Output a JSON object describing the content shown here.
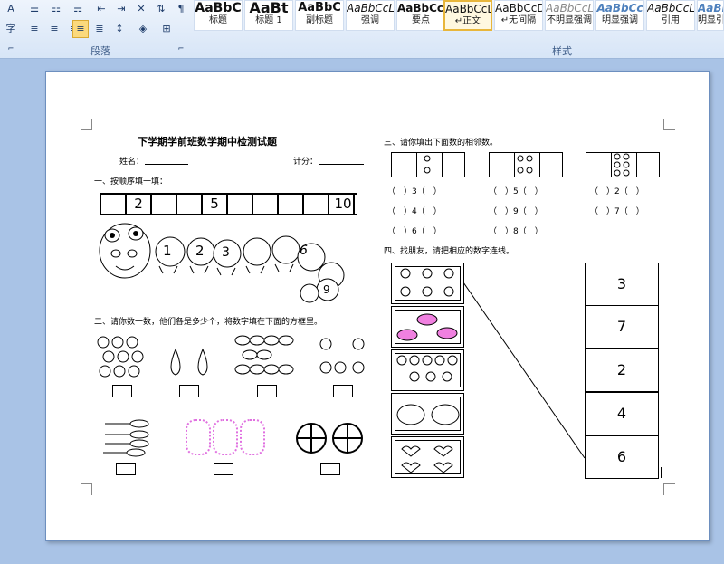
{
  "ribbon": {
    "group_paragraph": "段落",
    "group_styles": "样式",
    "styles": [
      {
        "preview": "AaBbC",
        "label": "标题"
      },
      {
        "preview": "AaBt",
        "label": "标题 1"
      },
      {
        "preview": "AaBbC",
        "label": "副标题"
      },
      {
        "preview": "AaBbCcL",
        "label": "强调"
      },
      {
        "preview": "AaBbCcl",
        "label": "要点"
      },
      {
        "preview": "AaBbCcD",
        "label": "↵正文"
      },
      {
        "preview": "AaBbCcD",
        "label": "↵无间隔"
      },
      {
        "preview": "AaBbCcL",
        "label": "不明显强调"
      },
      {
        "preview": "AaBbCc",
        "label": "明显强调"
      },
      {
        "preview": "AaBbCcL",
        "label": "引用"
      },
      {
        "preview": "AaBb",
        "label": "明显引"
      }
    ],
    "left_glyphs": [
      "A",
      "字"
    ]
  },
  "doc": {
    "title": "下学期学前班数学期中检测试题",
    "name_label": "姓名：",
    "score_label": "计分：",
    "q1": "一、按顺序填一填：",
    "seq": [
      "",
      "2",
      "",
      "",
      "5",
      "",
      "",
      "",
      "",
      "",
      "10"
    ],
    "caterpillar": [
      "1",
      "2",
      "3",
      "6",
      "9"
    ],
    "q2": "二、请你数一数，他们各是多少个，将数字填在下面的方框里。",
    "q3": "三、请你填出下面数的相邻数。",
    "neighbors": [
      [
        "（　）3（　）",
        "（　）5（　）",
        "（　）2（　）"
      ],
      [
        "（　）4（　）",
        "（　）9（　）",
        "（　）7（　）"
      ],
      [
        "（　）6（　）",
        "（　）8（　）",
        ""
      ]
    ],
    "q4": "四、找朋友，请把相应的数字连线。",
    "match_numbers": [
      "3",
      "7",
      "2",
      "4",
      "6"
    ]
  }
}
